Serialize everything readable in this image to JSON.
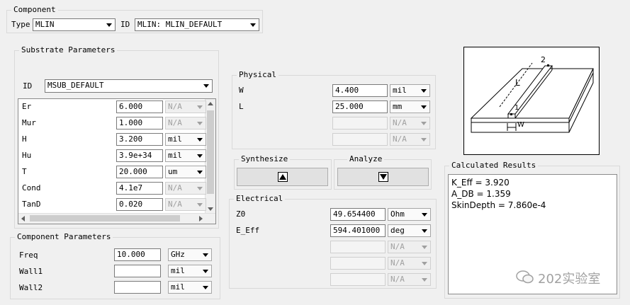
{
  "component": {
    "title": "Component",
    "type_label": "Type",
    "type_value": "MLIN",
    "id_label": "ID",
    "id_value": "MLIN: MLIN_DEFAULT"
  },
  "substrate": {
    "title": "Substrate Parameters",
    "id_label": "ID",
    "id_value": "MSUB_DEFAULT",
    "rows": [
      {
        "name": "Er",
        "value": "6.000",
        "unit": "N/A",
        "unit_disabled": true
      },
      {
        "name": "Mur",
        "value": "1.000",
        "unit": "N/A",
        "unit_disabled": true
      },
      {
        "name": "H",
        "value": "3.200",
        "unit": "mil",
        "unit_disabled": false
      },
      {
        "name": "Hu",
        "value": "3.9e+34",
        "unit": "mil",
        "unit_disabled": false
      },
      {
        "name": "T",
        "value": "20.000",
        "unit": "um",
        "unit_disabled": false
      },
      {
        "name": "Cond",
        "value": "4.1e7",
        "unit": "N/A",
        "unit_disabled": true
      },
      {
        "name": "TanD",
        "value": "0.020",
        "unit": "N/A",
        "unit_disabled": true
      }
    ]
  },
  "component_params": {
    "title": "Component Parameters",
    "rows": [
      {
        "name": "Freq",
        "value": "10.000",
        "unit": "GHz"
      },
      {
        "name": "Wall1",
        "value": "",
        "unit": "mil"
      },
      {
        "name": "Wall2",
        "value": "",
        "unit": "mil"
      }
    ]
  },
  "physical": {
    "title": "Physical",
    "rows": [
      {
        "name": "W",
        "value": "4.400",
        "unit": "mil",
        "disabled": false
      },
      {
        "name": "L",
        "value": "25.000",
        "unit": "mm",
        "disabled": false
      },
      {
        "name": "",
        "value": "",
        "unit": "N/A",
        "disabled": true
      },
      {
        "name": "",
        "value": "",
        "unit": "N/A",
        "disabled": true
      }
    ]
  },
  "synthesize": {
    "title": "Synthesize"
  },
  "analyze": {
    "title": "Analyze"
  },
  "electrical": {
    "title": "Electrical",
    "rows": [
      {
        "name": "Z0",
        "value": "49.654400",
        "unit": "Ohm",
        "disabled": false
      },
      {
        "name": "E_Eff",
        "value": "594.401000",
        "unit": "deg",
        "disabled": false
      },
      {
        "name": "",
        "value": "",
        "unit": "N/A",
        "disabled": true
      },
      {
        "name": "",
        "value": "",
        "unit": "N/A",
        "disabled": true
      },
      {
        "name": "",
        "value": "",
        "unit": "N/A",
        "disabled": true
      }
    ]
  },
  "diagram": {
    "label_port2": "2",
    "label_port1": "1",
    "label_L": "L",
    "label_W": "W"
  },
  "results": {
    "title": "Calculated Results",
    "lines": [
      "K_Eff = 3.920",
      "A_DB = 1.359",
      "SkinDepth = 7.860e-4"
    ]
  },
  "watermark": {
    "text": "202实验室"
  }
}
